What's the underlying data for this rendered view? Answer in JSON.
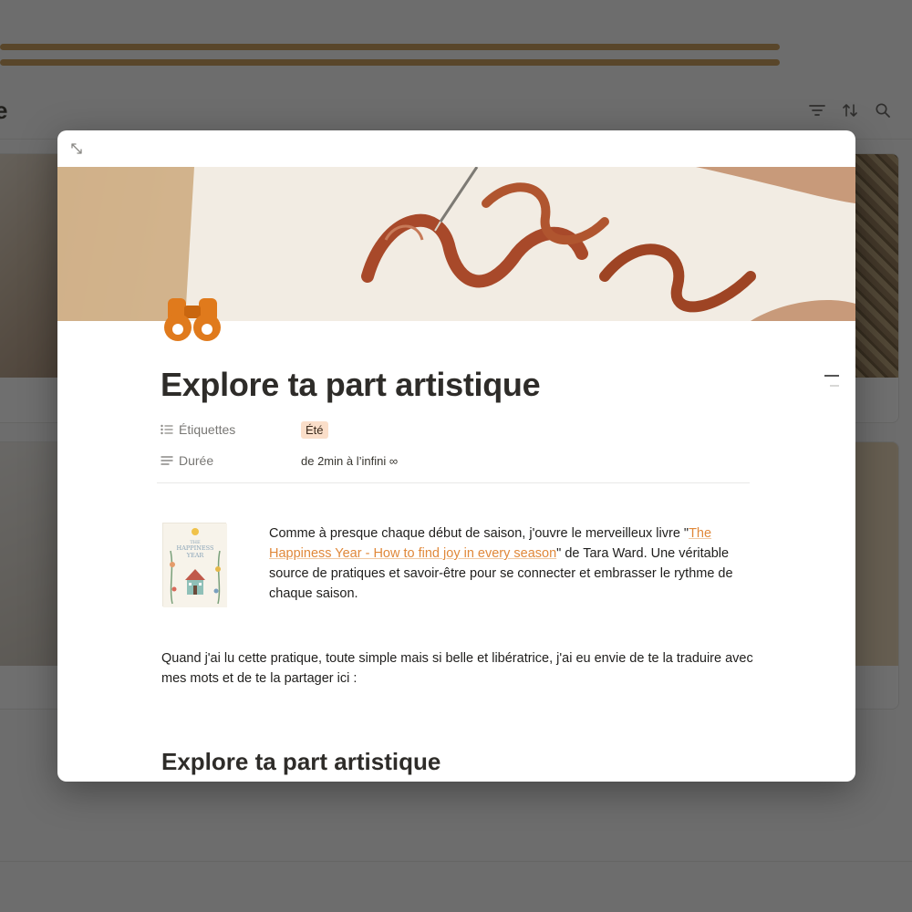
{
  "background": {
    "title_fragment": "e",
    "toolbar": {
      "filter_icon": "filter-icon",
      "sort_icon": "sort-icon",
      "search_icon": "search-icon"
    }
  },
  "modal": {
    "expand_icon": "expand-diagonal-icon",
    "page_icon": "binoculars-icon",
    "title": "Explore ta part artistique",
    "properties": [
      {
        "icon": "list-icon",
        "name": "Étiquettes",
        "value": "Été",
        "type": "tag"
      },
      {
        "icon": "text-lines-icon",
        "name": "Durée",
        "value": "de 2min à l’infini ∞",
        "type": "text"
      }
    ],
    "intro": {
      "before_link": "Comme à presque chaque début de saison, j'ouvre le merveilleux livre \"",
      "link_text": "The Happiness Year - How to find joy in every season",
      "after_link": "\" de Tara Ward. Une véritable source de pratiques et savoir-être pour se connecter et embrasser le rythme de chaque saison."
    },
    "paragraph_2": "Quand j'ai lu cette pratique, toute simple mais si belle et libératrice, j'ai eu envie de te la traduire avec mes mots et de te la partager ici :",
    "heading_2": "Explore ta part artistique",
    "book_cover": {
      "title_line1": "THE",
      "title_line2": "HAPPINESS",
      "title_line3": "YEAR"
    }
  },
  "colors": {
    "accent_link": "#e0883a",
    "tag_bg": "#fadec9",
    "icon_orange": "#e07a1c",
    "overlay": "rgba(15,15,15,0.6)"
  }
}
